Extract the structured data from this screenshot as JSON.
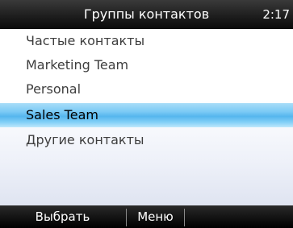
{
  "header": {
    "title": "Группы контактов",
    "time": "2:17"
  },
  "list": {
    "items": [
      {
        "label": "Частые контакты",
        "selected": false
      },
      {
        "label": "Marketing Team",
        "selected": false
      },
      {
        "label": "Personal",
        "selected": false
      },
      {
        "label": "Sales Team",
        "selected": true
      },
      {
        "label": "Другие контакты",
        "selected": false
      }
    ]
  },
  "softkeys": {
    "left_label": "Выбрать",
    "right_label": "Меню"
  },
  "colors": {
    "highlight": "#55b6ee",
    "title_bar": "#1e1e1e"
  }
}
